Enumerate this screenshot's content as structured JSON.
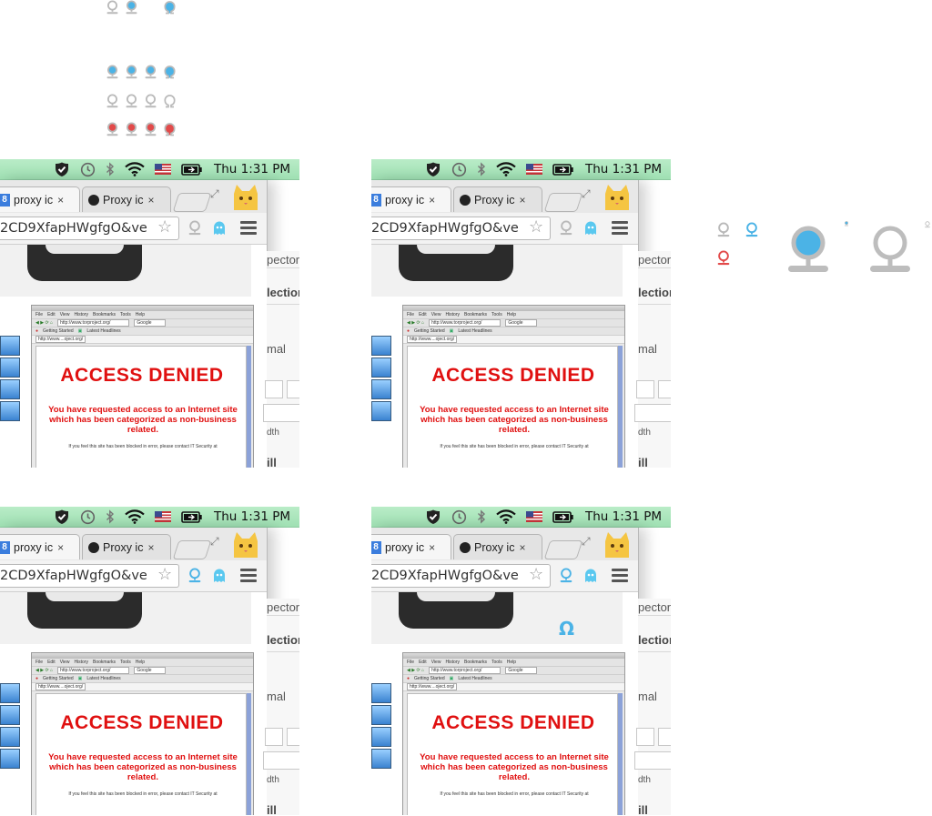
{
  "icon_rows": {
    "row1": [
      "outline",
      "blue",
      "blank",
      "omega-blue"
    ],
    "row2": [
      "blue",
      "blue",
      "blue",
      "omega-blue"
    ],
    "row3": [
      "outline",
      "outline",
      "outline",
      "omega-outline"
    ],
    "row4": [
      "red",
      "red",
      "red",
      "omega-red"
    ]
  },
  "colors": {
    "blue": "#4bb3e6",
    "grey": "#b9b9b9",
    "red": "#e24a4a",
    "menubar": "#a9e6bc",
    "denied_red": "#e01010"
  },
  "menubar": {
    "clock": "Thu 1:31 PM",
    "icons": [
      "checkmark-shield-icon",
      "time-machine-icon",
      "bluetooth-icon",
      "wifi-icon",
      "flag-icon",
      "battery-icon"
    ]
  },
  "browser": {
    "tab1": {
      "label": "proxy ic",
      "close": "×"
    },
    "tab2": {
      "label": "Proxy ic",
      "close": "×"
    },
    "url": "2CD9XfapHWgfgO&ve",
    "page": {
      "embedded_screenshot": {
        "menu": [
          "File",
          "Edit",
          "View",
          "History",
          "Bookmarks",
          "Tools",
          "Help"
        ],
        "address": "http://www.torproject.org/",
        "search": "Google",
        "bookmarks": [
          "Getting Started",
          "Latest Headlines"
        ],
        "tab": "http://www....oject.org/",
        "headline": "ACCESS DENIED",
        "message": "You have requested access to an Internet site which has been categorized as non-business related.",
        "footnote": "If you feel this site has been blocked in error, please contact IT Security at"
      },
      "behind_window": [
        "pector",
        "lectior",
        "mal",
        "dth",
        "ill"
      ]
    }
  },
  "panels": [
    {
      "id": "top-left",
      "toolbar_state": "grey"
    },
    {
      "id": "top-right",
      "toolbar_state": "grey"
    },
    {
      "id": "bottom-left",
      "toolbar_state": "blue"
    },
    {
      "id": "bottom-right",
      "toolbar_state": "blue-omega"
    }
  ],
  "omega_glyph": "Ω"
}
